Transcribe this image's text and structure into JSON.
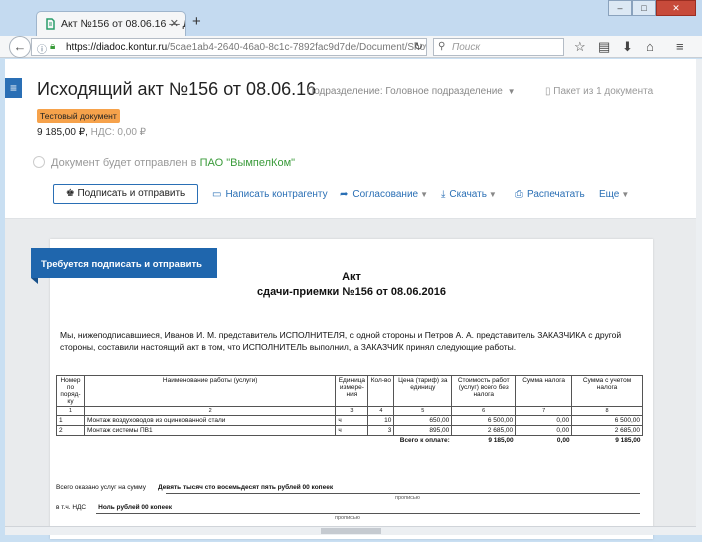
{
  "browser": {
    "tab_title": "Акт №156 от 08.06.16 — Д...",
    "tab_close": "✕",
    "new_tab": "+",
    "url_domain": "https://diadoc.kontur.ru",
    "url_path": "/5cae1ab4-2640-46a0-8c1c-7892fac9d7de/Document/Show?le",
    "search_placeholder": "Поиск",
    "icons": [
      "back-icon",
      "info-icon",
      "lock-icon",
      "reload-icon",
      "search-icon",
      "star-icon",
      "reading-list-icon",
      "download-icon",
      "home-icon",
      "menu-icon"
    ]
  },
  "header": {
    "title": "Исходящий акт №156 от 08.06.16",
    "division": "Подразделение: Головное подразделение",
    "packet": "Пакет из 1 документа",
    "badge": "Тестовый документ",
    "amount": "9 185,00 ₽,",
    "vat": "НДС: 0,00 ₽",
    "recipient_prefix": "Документ будет отправлен в",
    "recipient_name": "ПАО \"ВымпелКом\"",
    "colors": {
      "accent": "#2a6fb5",
      "badge": "#f6a24b",
      "recipient": "#3a9b3a"
    }
  },
  "actions": {
    "sign_send": "Подписать и отправить",
    "write": "Написать контрагенту",
    "approval": "Согласование",
    "download": "Скачать",
    "print": "Распечатать",
    "more": "Еще"
  },
  "document": {
    "flag": "Требуется подписать и отправить",
    "title_line1": "Акт",
    "title_line2": "сдачи-приемки №156 от 08.06.2016",
    "intro": "Мы, нижеподписавшиеся, Иванов И. М. представитель ИСПОЛНИТЕЛЯ, с одной стороны и Петров А. А. представитель ЗАКАЗЧИКА с другой стороны, составили настоящий акт в том, что ИСПОЛНИТЕЛЬ выполнил, а ЗАКАЗЧИК принял следующие работы.",
    "columns": [
      "Номер по поряд-ку",
      "Наименование работы (услуги)",
      "Единица измере-ния",
      "Кол-во",
      "Цена (тариф) за единицу",
      "Стоимость работ (услуг) всего без налога",
      "Сумма налога",
      "Сумма с учетом налога"
    ],
    "col_numbers": [
      "1",
      "2",
      "3",
      "4",
      "5",
      "6",
      "7",
      "8"
    ],
    "rows": [
      [
        "1",
        "Монтаж воздуховодов из оцинкованной стали",
        "ч",
        "10",
        "650,00",
        "6 500,00",
        "0,00",
        "6 500,00"
      ],
      [
        "2",
        "Монтаж системы ПВ1",
        "ч",
        "3",
        "895,00",
        "2 685,00",
        "0,00",
        "2 685,00"
      ]
    ],
    "total_label": "Всего к оплате:",
    "total_net": "9 185,00",
    "total_tax": "0,00",
    "total_gross": "9 185,00",
    "sum_label": "Всего оказано услуг на сумму",
    "sum_words": "Девять тысяч сто восемьдесят пять рублей 00 копеек",
    "hint": "прописью",
    "vat_label": "в т.ч. НДС",
    "vat_words": "Ноль рублей 00 копеек"
  }
}
